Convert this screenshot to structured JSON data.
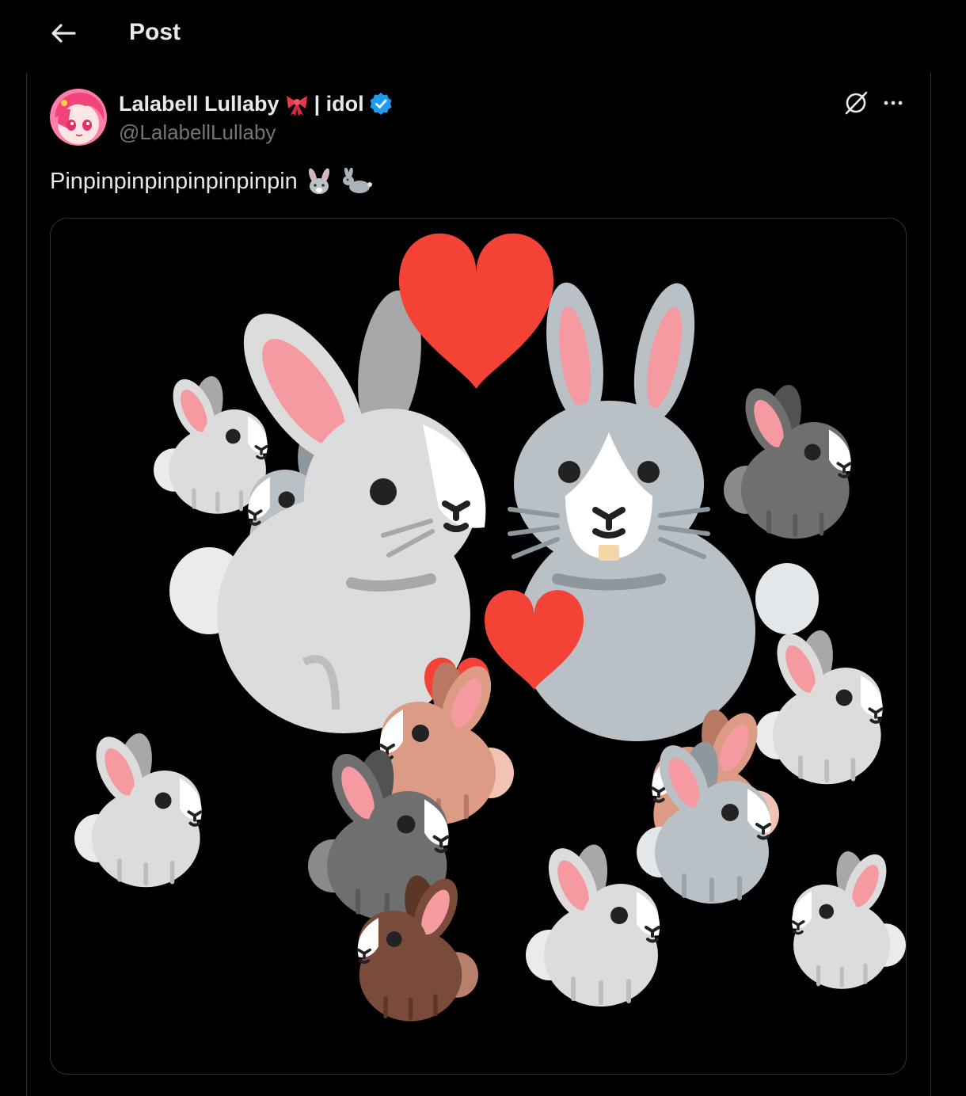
{
  "header": {
    "title": "Post",
    "back_icon": "arrow-left-icon"
  },
  "post": {
    "author_name": "Lalabell Lullaby",
    "name_suffix": "| idol",
    "ribbon_emoji": "🎀",
    "verified_icon": "verified-badge-icon",
    "handle": "@LalabellLullaby",
    "text": "Pinpinpinpinpinpinpinpin",
    "text_emojis": [
      "rabbit-face-emoji",
      "rabbit-emoji"
    ],
    "image": {
      "description_icon": "bunnies-with-hearts-image"
    }
  },
  "colors": {
    "background": "#000000",
    "text": "#e7e9ea",
    "secondary_text": "#71767b",
    "verified": "#1d9bf0",
    "heart": "#f44336"
  }
}
